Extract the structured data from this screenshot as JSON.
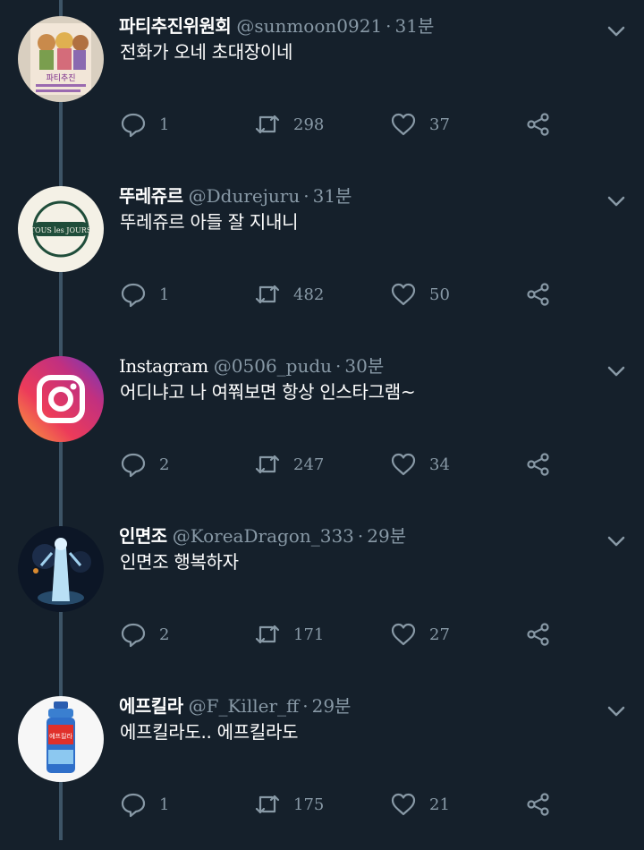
{
  "tweets": [
    {
      "name": "파티추진위원회",
      "handle": "@sunmoon0921",
      "sep": "·",
      "time": "31분",
      "text": "전화가 오네 초대장이네",
      "replies": "1",
      "retweets": "298",
      "likes": "37",
      "avatar": "party-flyer"
    },
    {
      "name": "뚜레쥬르",
      "handle": "@Ddurejuru",
      "sep": "·",
      "time": "31분",
      "text": "뚜레쥬르 아들 잘 지내니",
      "replies": "1",
      "retweets": "482",
      "likes": "50",
      "avatar": "tous-les-jours-logo"
    },
    {
      "name": "Instagram",
      "handle": "@0506_pudu",
      "sep": "·",
      "time": "30분",
      "text": "어디냐고 나 여쭤보면 항상 인스타그램~",
      "replies": "2",
      "retweets": "247",
      "likes": "34",
      "avatar": "instagram-logo"
    },
    {
      "name": "인면조",
      "handle": "@KoreaDragon_333",
      "sep": "·",
      "time": "29분",
      "text": "인면조 행복하자",
      "replies": "2",
      "retweets": "171",
      "likes": "27",
      "avatar": "glowing-figure"
    },
    {
      "name": "에프킬라",
      "handle": "@F_Killer_ff",
      "sep": "·",
      "time": "29분",
      "text": "에프킬라도.. 에프킬라도",
      "replies": "1",
      "retweets": "175",
      "likes": "21",
      "avatar": "spray-can"
    }
  ],
  "avatar_texts": {
    "tous_les_jours": "TOUS les JOURS",
    "party_flyer": "파티추진",
    "fkiller": "에프킬라"
  },
  "icons": {
    "reply": "speech-bubble-icon",
    "retweet": "retweet-arrows-icon",
    "like": "heart-icon",
    "share": "share-nodes-icon",
    "menu": "chevron-down-icon"
  },
  "colors": {
    "background": "#15202b",
    "text": "#ffffff",
    "secondary": "#8899a6",
    "thread_line": "#3d5466"
  }
}
